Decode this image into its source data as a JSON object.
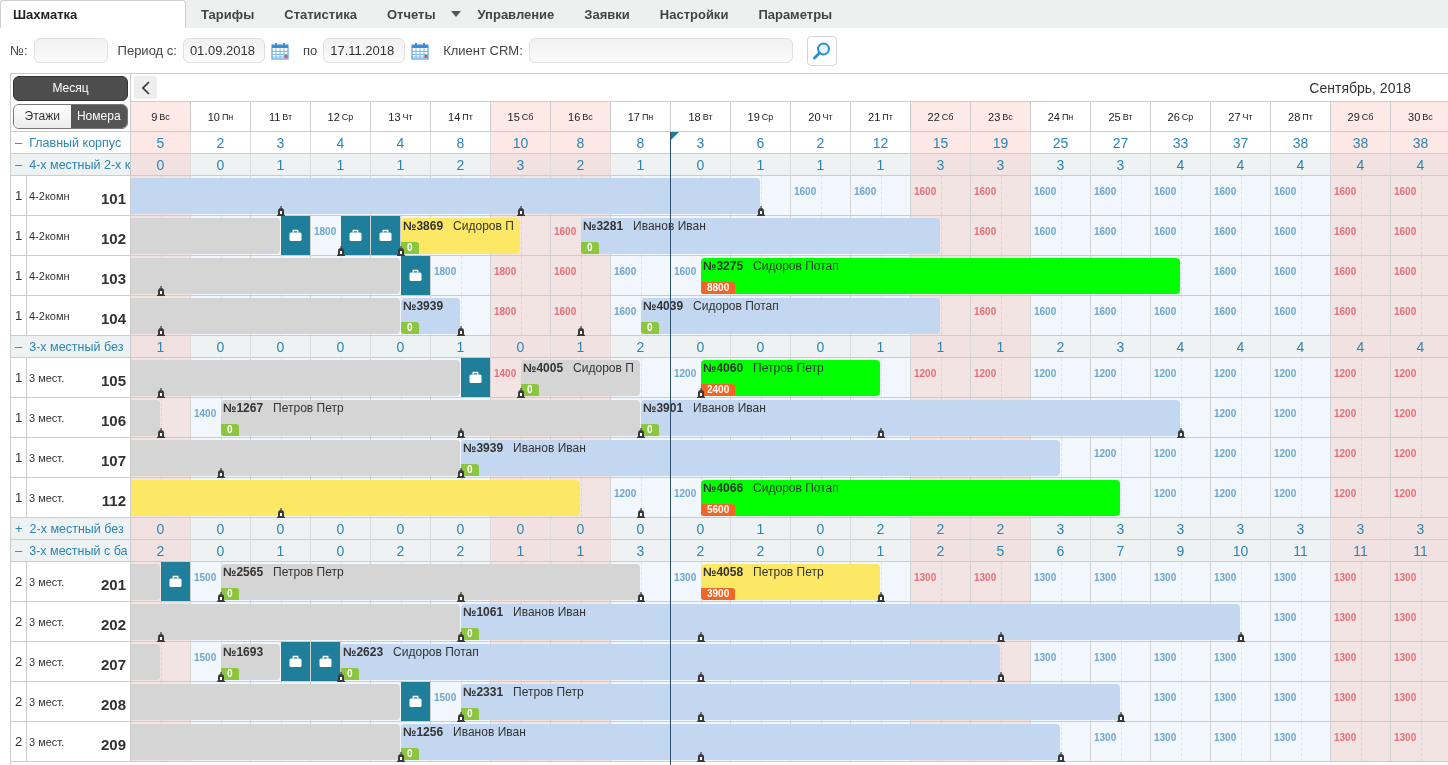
{
  "tabs": [
    {
      "label": "Шахматка",
      "selected": true,
      "dropdown": false
    },
    {
      "label": "Тарифы",
      "selected": false,
      "dropdown": false
    },
    {
      "label": "Статистика",
      "selected": false,
      "dropdown": false
    },
    {
      "label": "Отчеты",
      "selected": false,
      "dropdown": true
    },
    {
      "label": "Управление",
      "selected": false,
      "dropdown": false
    },
    {
      "label": "Заявки",
      "selected": false,
      "dropdown": false
    },
    {
      "label": "Настройки",
      "selected": false,
      "dropdown": false
    },
    {
      "label": "Параметры",
      "selected": false,
      "dropdown": false
    }
  ],
  "filters": [
    {
      "kind": "text",
      "label": "№:"
    },
    {
      "kind": "date",
      "label": "Период с:",
      "value": "01.09.2018"
    },
    {
      "kind": "date",
      "label": "по",
      "value": "17.11.2018"
    },
    {
      "kind": "wide",
      "label": "Клиент CRM:"
    }
  ],
  "view": {
    "month_button": "Месяц",
    "modes": [
      {
        "label": "Этажи",
        "selected": false
      },
      {
        "label": "Номера",
        "selected": true
      }
    ],
    "month_title": "Сентябрь, 2018"
  },
  "days": [
    {
      "day": "9",
      "weekday": "Вс",
      "weekend": true,
      "today": false
    },
    {
      "day": "10",
      "weekday": "Пн",
      "weekend": false,
      "today": false
    },
    {
      "day": "11",
      "weekday": "Вт",
      "weekend": false,
      "today": false
    },
    {
      "day": "12",
      "weekday": "Ср",
      "weekend": false,
      "today": false
    },
    {
      "day": "13",
      "weekday": "Чт",
      "weekend": false,
      "today": false
    },
    {
      "day": "14",
      "weekday": "Пт",
      "weekend": false,
      "today": false
    },
    {
      "day": "15",
      "weekday": "Сб",
      "weekend": true,
      "today": false
    },
    {
      "day": "16",
      "weekday": "Вс",
      "weekend": true,
      "today": false
    },
    {
      "day": "17",
      "weekday": "Пн",
      "weekend": false,
      "today": false
    },
    {
      "day": "18",
      "weekday": "Вт",
      "weekend": false,
      "today": true
    },
    {
      "day": "19",
      "weekday": "Ср",
      "weekend": false,
      "today": false
    },
    {
      "day": "20",
      "weekday": "Чт",
      "weekend": false,
      "today": false
    },
    {
      "day": "21",
      "weekday": "Пт",
      "weekend": false,
      "today": false
    },
    {
      "day": "22",
      "weekday": "Сб",
      "weekend": true,
      "today": false
    },
    {
      "day": "23",
      "weekday": "Вс",
      "weekend": true,
      "today": false
    },
    {
      "day": "24",
      "weekday": "Пн",
      "weekend": false,
      "today": false
    },
    {
      "day": "25",
      "weekday": "Вт",
      "weekend": false,
      "today": false
    },
    {
      "day": "26",
      "weekday": "Ср",
      "weekend": false,
      "today": false
    },
    {
      "day": "27",
      "weekday": "Чт",
      "weekend": false,
      "today": false
    },
    {
      "day": "28",
      "weekday": "Пт",
      "weekend": false,
      "today": false
    },
    {
      "day": "29",
      "weekday": "Сб",
      "weekend": true,
      "today": false
    },
    {
      "day": "30",
      "weekday": "Вс",
      "weekend": true,
      "today": false
    }
  ],
  "rows": [
    {
      "kind": "building",
      "toggle": "–",
      "name": "Главный корпус",
      "counts": [
        "5",
        "2",
        "3",
        "4",
        "4",
        "8",
        "10",
        "8",
        "8",
        "3",
        "6",
        "2",
        "12",
        "15",
        "19",
        "25",
        "27",
        "33",
        "37",
        "38",
        "38",
        "38"
      ]
    },
    {
      "kind": "category",
      "toggle": "–",
      "name": "4-х местный 2-х к",
      "counts": [
        "0",
        "0",
        "1",
        "1",
        "1",
        "2",
        "3",
        "2",
        "1",
        "0",
        "1",
        "1",
        "1",
        "3",
        "3",
        "3",
        "3",
        "4",
        "4",
        "4",
        "4",
        "4"
      ]
    },
    {
      "kind": "room",
      "floor": "1",
      "room_type": "4-2комн",
      "number": "101",
      "cells": [
        {
          "marker": false,
          "arrivals": [
            {
              "kind": "booking",
              "color": "#c4d7f0",
              "continued": true
            }
          ]
        },
        {
          "marker": false
        },
        {
          "marker": true
        },
        {
          "marker": false
        },
        {
          "marker": false
        },
        {
          "marker": false
        },
        {
          "marker": true
        },
        {
          "marker": false
        },
        {
          "marker": false
        },
        {
          "marker": false
        },
        {
          "marker": true,
          "departures": [
            {
              "midday": true
            }
          ]
        },
        {
          "marker": false,
          "price": "1600"
        },
        {
          "marker": false,
          "price": "1600"
        },
        {
          "marker": false,
          "price": "1600"
        },
        {
          "marker": false,
          "price": "1600"
        },
        {
          "marker": false,
          "price": "1600"
        },
        {
          "marker": false,
          "price": "1600"
        },
        {
          "marker": false,
          "price": "1600"
        },
        {
          "marker": false,
          "price": "1600"
        },
        {
          "marker": false,
          "price": "1600"
        },
        {
          "marker": false,
          "price": "1600"
        },
        {
          "marker": false,
          "price": "1600"
        }
      ]
    },
    {
      "kind": "room",
      "floor": "1",
      "room_type": "4-2комн",
      "number": "102",
      "cells": [
        {
          "marker": false,
          "arrivals": [
            {
              "kind": "booking",
              "color": "#d5d5d5",
              "continued": true
            }
          ]
        },
        {
          "marker": false
        },
        {
          "marker": false,
          "departures": [
            {
              "midday": true
            }
          ],
          "arrivals": [
            {
              "kind": "luggage",
              "color": "#1f7f9a",
              "continued": false,
              "midday": true
            }
          ]
        },
        {
          "marker": true,
          "price": "1800",
          "departures": [
            {
              "midday": false
            }
          ],
          "arrivals": [
            {
              "kind": "luggage",
              "color": "#1f7f9a",
              "continued": false,
              "midday": true
            }
          ]
        },
        {
          "marker": true,
          "departures": [
            {
              "midday": false
            },
            {
              "midday": true
            }
          ],
          "arrivals": [
            {
              "kind": "luggage",
              "color": "#1f7f9a",
              "continued": false,
              "midday": false
            },
            {
              "kind": "booking",
              "color": "#fde866",
              "continued": false,
              "midday": true,
              "label": "**№3869**   Сидоров П",
              "badge": {
                "text": "0",
                "color": "#8cc63f"
              }
            }
          ]
        },
        {
          "marker": false
        },
        {
          "marker": false,
          "departures": [
            {
              "midday": true
            }
          ]
        },
        {
          "marker": false,
          "price": "1600",
          "arrivals": [
            {
              "kind": "booking",
              "color": "#c4d7f0",
              "continued": false,
              "midday": true,
              "label": "**№3281**   Иванов Иван",
              "badge": {
                "text": "0",
                "color": "#8cc63f"
              }
            }
          ]
        },
        {
          "marker": false
        },
        {
          "marker": false
        },
        {
          "marker": false
        },
        {
          "marker": false
        },
        {
          "marker": false
        },
        {
          "marker": false,
          "departures": [
            {
              "midday": true
            }
          ]
        },
        {
          "marker": false,
          "price": "1600"
        },
        {
          "marker": false,
          "price": "1600"
        },
        {
          "marker": false,
          "price": "1600"
        },
        {
          "marker": false,
          "price": "1600"
        },
        {
          "marker": false,
          "price": "1600"
        },
        {
          "marker": false,
          "price": "1600"
        },
        {
          "marker": false,
          "price": "1600"
        },
        {
          "marker": false,
          "price": "1600"
        }
      ]
    },
    {
      "kind": "room",
      "floor": "1",
      "room_type": "4-2комн",
      "number": "103",
      "cells": [
        {
          "marker": true,
          "arrivals": [
            {
              "kind": "booking",
              "color": "#d5d5d5",
              "continued": true
            }
          ]
        },
        {
          "marker": false
        },
        {
          "marker": false
        },
        {
          "marker": false
        },
        {
          "marker": false,
          "departures": [
            {
              "midday": true
            }
          ],
          "arrivals": [
            {
              "kind": "luggage",
              "color": "#1f7f9a",
              "continued": false,
              "midday": true
            }
          ]
        },
        {
          "marker": false,
          "price": "1800",
          "departures": [
            {
              "midday": false
            }
          ]
        },
        {
          "marker": false,
          "price": "1800"
        },
        {
          "marker": false,
          "price": "1600"
        },
        {
          "marker": false,
          "price": "1600"
        },
        {
          "marker": false,
          "price": "1600",
          "arrivals": [
            {
              "kind": "booking",
              "color": "#00ff00",
              "continued": false,
              "midday": true,
              "label": "**№3275**   Сидоров Потап",
              "badge": {
                "text": "8800",
                "color": "#f26522"
              }
            }
          ]
        },
        {
          "marker": false
        },
        {
          "marker": false
        },
        {
          "marker": false
        },
        {
          "marker": false
        },
        {
          "marker": false
        },
        {
          "marker": false
        },
        {
          "marker": false
        },
        {
          "marker": false,
          "departures": [
            {
              "midday": true
            }
          ]
        },
        {
          "marker": false,
          "price": "1600"
        },
        {
          "marker": false,
          "price": "1600"
        },
        {
          "marker": false,
          "price": "1600"
        },
        {
          "marker": false,
          "price": "1600"
        }
      ]
    },
    {
      "kind": "room",
      "floor": "1",
      "room_type": "4-2комн",
      "number": "104",
      "cells": [
        {
          "marker": true,
          "arrivals": [
            {
              "kind": "booking",
              "color": "#d5d5d5",
              "continued": true
            }
          ]
        },
        {
          "marker": false
        },
        {
          "marker": false
        },
        {
          "marker": false
        },
        {
          "marker": false,
          "departures": [
            {
              "midday": true
            }
          ],
          "arrivals": [
            {
              "kind": "booking",
              "color": "#c4d7f0",
              "continued": false,
              "midday": true,
              "label": "**№3939**",
              "badge": {
                "text": "0",
                "color": "#8cc63f"
              }
            }
          ]
        },
        {
          "marker": true,
          "departures": [
            {
              "midday": true
            }
          ]
        },
        {
          "marker": false,
          "price": "1800"
        },
        {
          "marker": true,
          "price": "1600"
        },
        {
          "marker": false,
          "price": "1600",
          "arrivals": [
            {
              "kind": "booking",
              "color": "#c4d7f0",
              "continued": false,
              "midday": true,
              "label": "**№4039**   Сидоров Потап",
              "badge": {
                "text": "0",
                "color": "#8cc63f"
              }
            }
          ]
        },
        {
          "marker": false
        },
        {
          "marker": false
        },
        {
          "marker": false
        },
        {
          "marker": false
        },
        {
          "marker": false,
          "departures": [
            {
              "midday": true
            }
          ]
        },
        {
          "marker": false,
          "price": "1600"
        },
        {
          "marker": false,
          "price": "1600"
        },
        {
          "marker": false,
          "price": "1600"
        },
        {
          "marker": false,
          "price": "1600"
        },
        {
          "marker": false,
          "price": "1600"
        },
        {
          "marker": false,
          "price": "1600"
        },
        {
          "marker": false,
          "price": "1600"
        },
        {
          "marker": false,
          "price": "1600"
        }
      ]
    },
    {
      "kind": "category",
      "toggle": "–",
      "name": "3-х местный без",
      "counts": [
        "1",
        "0",
        "0",
        "0",
        "0",
        "1",
        "0",
        "1",
        "2",
        "0",
        "0",
        "0",
        "1",
        "1",
        "1",
        "2",
        "3",
        "4",
        "4",
        "4",
        "4",
        "4"
      ]
    },
    {
      "kind": "room",
      "floor": "1",
      "room_type": "3 мест.",
      "number": "105",
      "cells": [
        {
          "marker": true,
          "arrivals": [
            {
              "kind": "booking",
              "color": "#d5d5d5",
              "continued": true
            }
          ]
        },
        {
          "marker": false
        },
        {
          "marker": false
        },
        {
          "marker": false
        },
        {
          "marker": false
        },
        {
          "marker": false,
          "departures": [
            {
              "midday": true
            }
          ],
          "arrivals": [
            {
              "kind": "luggage",
              "color": "#1f7f9a",
              "continued": false,
              "midday": true
            }
          ]
        },
        {
          "marker": true,
          "price": "1400",
          "departures": [
            {
              "midday": false
            }
          ],
          "arrivals": [
            {
              "kind": "booking",
              "color": "#d5d5d5",
              "continued": false,
              "midday": true,
              "label": "**№4005**   Сидоров П",
              "badge": {
                "text": "0",
                "color": "#8cc63f"
              }
            }
          ]
        },
        {
          "marker": false
        },
        {
          "marker": false,
          "departures": [
            {
              "midday": true
            }
          ]
        },
        {
          "marker": true,
          "price": "1200",
          "arrivals": [
            {
              "kind": "booking",
              "color": "#00ff00",
              "continued": false,
              "midday": true,
              "label": "**№4060**   Петров Петр",
              "badge": {
                "text": "2400",
                "color": "#f26522"
              }
            }
          ]
        },
        {
          "marker": false
        },
        {
          "marker": false
        },
        {
          "marker": false,
          "departures": [
            {
              "midday": true
            }
          ]
        },
        {
          "marker": false,
          "price": "1200"
        },
        {
          "marker": false,
          "price": "1200"
        },
        {
          "marker": false,
          "price": "1200"
        },
        {
          "marker": false,
          "price": "1200"
        },
        {
          "marker": false,
          "price": "1200"
        },
        {
          "marker": false,
          "price": "1200"
        },
        {
          "marker": false,
          "price": "1200"
        },
        {
          "marker": false,
          "price": "1200"
        },
        {
          "marker": false,
          "price": "1200"
        }
      ]
    },
    {
      "kind": "room",
      "floor": "1",
      "room_type": "3 мест.",
      "number": "106",
      "cells": [
        {
          "marker": true,
          "arrivals": [
            {
              "kind": "booking",
              "color": "#d5d5d5",
              "continued": true
            }
          ],
          "departures": [
            {
              "midday": true
            }
          ]
        },
        {
          "marker": false,
          "price": "1400",
          "arrivals": [
            {
              "kind": "booking",
              "color": "#d5d5d5",
              "continued": false,
              "midday": true,
              "label": "**№1267**   Петров Петр",
              "badge": {
                "text": "0",
                "color": "#8cc63f"
              }
            }
          ]
        },
        {
          "marker": false
        },
        {
          "marker": false
        },
        {
          "marker": false
        },
        {
          "marker": true
        },
        {
          "marker": false
        },
        {
          "marker": false
        },
        {
          "marker": true,
          "departures": [
            {
              "midday": true
            }
          ],
          "arrivals": [
            {
              "kind": "booking",
              "color": "#c4d7f0",
              "continued": false,
              "midday": true,
              "label": "**№3901**   Иванов Иван",
              "badge": {
                "text": "0",
                "color": "#8cc63f"
              }
            }
          ]
        },
        {
          "marker": false
        },
        {
          "marker": false
        },
        {
          "marker": false
        },
        {
          "marker": true
        },
        {
          "marker": false
        },
        {
          "marker": false
        },
        {
          "marker": false
        },
        {
          "marker": false
        },
        {
          "marker": true,
          "departures": [
            {
              "midday": true
            }
          ]
        },
        {
          "marker": false,
          "price": "1200"
        },
        {
          "marker": false,
          "price": "1200"
        },
        {
          "marker": false,
          "price": "1200"
        },
        {
          "marker": false,
          "price": "1200"
        }
      ]
    },
    {
      "kind": "room",
      "floor": "1",
      "room_type": "3 мест.",
      "number": "107",
      "cells": [
        {
          "marker": false,
          "arrivals": [
            {
              "kind": "booking",
              "color": "#d5d5d5",
              "continued": true
            }
          ]
        },
        {
          "marker": true
        },
        {
          "marker": false
        },
        {
          "marker": false
        },
        {
          "marker": false
        },
        {
          "marker": true,
          "departures": [
            {
              "midday": true
            }
          ],
          "arrivals": [
            {
              "kind": "booking",
              "color": "#c4d7f0",
              "continued": false,
              "midday": true,
              "label": "**№3939**   Иванов Иван",
              "badge": {
                "text": "0",
                "color": "#8cc63f"
              }
            }
          ]
        },
        {
          "marker": false
        },
        {
          "marker": false
        },
        {
          "marker": false
        },
        {
          "marker": false
        },
        {
          "marker": false
        },
        {
          "marker": false
        },
        {
          "marker": false
        },
        {
          "marker": false
        },
        {
          "marker": false
        },
        {
          "marker": false,
          "departures": [
            {
              "midday": true
            }
          ]
        },
        {
          "marker": false,
          "price": "1200"
        },
        {
          "marker": false,
          "price": "1200"
        },
        {
          "marker": false,
          "price": "1200"
        },
        {
          "marker": false,
          "price": "1200"
        },
        {
          "marker": false,
          "price": "1200"
        },
        {
          "marker": false,
          "price": "1200"
        }
      ]
    },
    {
      "kind": "room",
      "floor": "1",
      "room_type": "3 мест.",
      "number": "112",
      "cells": [
        {
          "marker": false,
          "arrivals": [
            {
              "kind": "booking",
              "color": "#fde866",
              "continued": true
            }
          ]
        },
        {
          "marker": false
        },
        {
          "marker": true
        },
        {
          "marker": false
        },
        {
          "marker": false
        },
        {
          "marker": false
        },
        {
          "marker": false
        },
        {
          "marker": false,
          "departures": [
            {
              "midday": true
            }
          ]
        },
        {
          "marker": true,
          "price": "1200"
        },
        {
          "marker": false,
          "price": "1200",
          "arrivals": [
            {
              "kind": "booking",
              "color": "#00ff00",
              "continued": false,
              "midday": true,
              "label": "**№4066**   Сидоров Потап",
              "badge": {
                "text": "5600",
                "color": "#f26522"
              }
            }
          ]
        },
        {
          "marker": false
        },
        {
          "marker": false
        },
        {
          "marker": false
        },
        {
          "marker": false
        },
        {
          "marker": false
        },
        {
          "marker": false
        },
        {
          "marker": false,
          "departures": [
            {
              "midday": true
            }
          ]
        },
        {
          "marker": false,
          "price": "1200"
        },
        {
          "marker": false,
          "price": "1200"
        },
        {
          "marker": false,
          "price": "1200"
        },
        {
          "marker": false,
          "price": "1200"
        },
        {
          "marker": false,
          "price": "1200"
        }
      ]
    },
    {
      "kind": "category",
      "toggle": "+",
      "name": "2-х местный без",
      "counts": [
        "0",
        "0",
        "0",
        "0",
        "0",
        "0",
        "0",
        "0",
        "0",
        "0",
        "1",
        "0",
        "2",
        "2",
        "2",
        "3",
        "3",
        "3",
        "3",
        "3",
        "3",
        "3"
      ]
    },
    {
      "kind": "category",
      "toggle": "–",
      "name": "3-х местный с ба",
      "counts": [
        "2",
        "0",
        "1",
        "0",
        "2",
        "2",
        "1",
        "1",
        "3",
        "2",
        "2",
        "0",
        "1",
        "2",
        "5",
        "6",
        "7",
        "9",
        "10",
        "11",
        "11",
        "11"
      ]
    },
    {
      "kind": "room",
      "floor": "2",
      "room_type": "3 мест.",
      "number": "201",
      "cells": [
        {
          "marker": false,
          "arrivals": [
            {
              "kind": "booking",
              "color": "#d5d5d5",
              "continued": true
            },
            {
              "kind": "luggage",
              "color": "#1f7f9a",
              "continued": false,
              "midday": true
            }
          ],
          "departures": [
            {
              "midday": true
            }
          ]
        },
        {
          "marker": true,
          "price": "1500",
          "departures": [
            {
              "midday": false
            }
          ],
          "arrivals": [
            {
              "kind": "booking",
              "color": "#d5d5d5",
              "continued": false,
              "midday": true,
              "label": "**№2565**   Петров Петр",
              "badge": {
                "text": "0",
                "color": "#8cc63f"
              }
            }
          ]
        },
        {
          "marker": false
        },
        {
          "marker": false
        },
        {
          "marker": false
        },
        {
          "marker": true
        },
        {
          "marker": false
        },
        {
          "marker": false
        },
        {
          "marker": true,
          "departures": [
            {
              "midday": true
            }
          ]
        },
        {
          "marker": false,
          "price": "1300",
          "arrivals": [
            {
              "kind": "booking",
              "color": "#fde866",
              "continued": false,
              "midday": true,
              "label": "**№4058**   Петров Петр",
              "badge": {
                "text": "3900",
                "color": "#f26522"
              }
            }
          ]
        },
        {
          "marker": false
        },
        {
          "marker": false
        },
        {
          "marker": true,
          "departures": [
            {
              "midday": true
            }
          ]
        },
        {
          "marker": false,
          "price": "1300"
        },
        {
          "marker": false,
          "price": "1300"
        },
        {
          "marker": false,
          "price": "1300"
        },
        {
          "marker": false,
          "price": "1300"
        },
        {
          "marker": false,
          "price": "1300"
        },
        {
          "marker": false,
          "price": "1300"
        },
        {
          "marker": false,
          "price": "1300"
        },
        {
          "marker": false,
          "price": "1300"
        },
        {
          "marker": false,
          "price": "1300"
        }
      ]
    },
    {
      "kind": "room",
      "floor": "2",
      "room_type": "3 мест.",
      "number": "202",
      "cells": [
        {
          "marker": true,
          "arrivals": [
            {
              "kind": "booking",
              "color": "#d5d5d5",
              "continued": true
            }
          ]
        },
        {
          "marker": false
        },
        {
          "marker": false
        },
        {
          "marker": false
        },
        {
          "marker": false
        },
        {
          "marker": true,
          "departures": [
            {
              "midday": true
            }
          ],
          "arrivals": [
            {
              "kind": "booking",
              "color": "#c4d7f0",
              "continued": false,
              "midday": true,
              "label": "**№1061**   Иванов Иван",
              "badge": {
                "text": "0",
                "color": "#8cc63f"
              }
            }
          ]
        },
        {
          "marker": false
        },
        {
          "marker": false
        },
        {
          "marker": false
        },
        {
          "marker": true
        },
        {
          "marker": false
        },
        {
          "marker": false
        },
        {
          "marker": false
        },
        {
          "marker": false
        },
        {
          "marker": true
        },
        {
          "marker": false
        },
        {
          "marker": false
        },
        {
          "marker": false
        },
        {
          "marker": true,
          "departures": [
            {
              "midday": true
            }
          ]
        },
        {
          "marker": false,
          "price": "1300"
        },
        {
          "marker": false,
          "price": "1300"
        },
        {
          "marker": false,
          "price": "1300"
        }
      ]
    },
    {
      "kind": "room",
      "floor": "2",
      "room_type": "3 мест.",
      "number": "207",
      "cells": [
        {
          "marker": false,
          "arrivals": [
            {
              "kind": "booking",
              "color": "#d5d5d5",
              "continued": true
            }
          ],
          "departures": [
            {
              "midday": true
            }
          ]
        },
        {
          "marker": true,
          "price": "1500",
          "arrivals": [
            {
              "kind": "booking",
              "color": "#d5d5d5",
              "continued": false,
              "midday": true,
              "label": "**№1693**",
              "badge": {
                "text": "0",
                "color": "#8cc63f"
              }
            }
          ]
        },
        {
          "marker": false,
          "departures": [
            {
              "midday": true
            }
          ],
          "arrivals": [
            {
              "kind": "luggage",
              "color": "#1f7f9a",
              "continued": false,
              "midday": true
            }
          ]
        },
        {
          "marker": true,
          "departures": [
            {
              "midday": false
            },
            {
              "midday": true
            }
          ],
          "arrivals": [
            {
              "kind": "luggage",
              "color": "#1f7f9a",
              "continued": false,
              "midday": false
            },
            {
              "kind": "booking",
              "color": "#c4d7f0",
              "continued": false,
              "midday": true,
              "label": "**№2623**   Сидоров Потап",
              "badge": {
                "text": "0",
                "color": "#8cc63f"
              }
            }
          ]
        },
        {
          "marker": false
        },
        {
          "marker": false
        },
        {
          "marker": false
        },
        {
          "marker": false
        },
        {
          "marker": false
        },
        {
          "marker": true
        },
        {
          "marker": false
        },
        {
          "marker": false
        },
        {
          "marker": false
        },
        {
          "marker": false
        },
        {
          "marker": true,
          "departures": [
            {
              "midday": true
            }
          ]
        },
        {
          "marker": false,
          "price": "1300"
        },
        {
          "marker": false,
          "price": "1300"
        },
        {
          "marker": false,
          "price": "1300"
        },
        {
          "marker": false,
          "price": "1300"
        },
        {
          "marker": false,
          "price": "1300"
        },
        {
          "marker": false,
          "price": "1300"
        },
        {
          "marker": false,
          "price": "1300"
        }
      ]
    },
    {
      "kind": "room",
      "floor": "2",
      "room_type": "3 мест.",
      "number": "208",
      "cells": [
        {
          "marker": false,
          "arrivals": [
            {
              "kind": "booking",
              "color": "#d5d5d5",
              "continued": true
            }
          ]
        },
        {
          "marker": false
        },
        {
          "marker": false
        },
        {
          "marker": false
        },
        {
          "marker": false,
          "departures": [
            {
              "midday": true
            }
          ],
          "arrivals": [
            {
              "kind": "luggage",
              "color": "#1f7f9a",
              "continued": false,
              "midday": true
            }
          ]
        },
        {
          "marker": true,
          "price": "1500",
          "departures": [
            {
              "midday": false
            }
          ],
          "arrivals": [
            {
              "kind": "booking",
              "color": "#c4d7f0",
              "continued": false,
              "midday": true,
              "label": "**№2331**   Петров Петр",
              "badge": {
                "text": "0",
                "color": "#8cc63f"
              }
            }
          ]
        },
        {
          "marker": false
        },
        {
          "marker": false
        },
        {
          "marker": false
        },
        {
          "marker": true
        },
        {
          "marker": false
        },
        {
          "marker": false
        },
        {
          "marker": false
        },
        {
          "marker": false
        },
        {
          "marker": false
        },
        {
          "marker": false
        },
        {
          "marker": true,
          "departures": [
            {
              "midday": true
            }
          ]
        },
        {
          "marker": false,
          "price": "1300"
        },
        {
          "marker": false,
          "price": "1300"
        },
        {
          "marker": false,
          "price": "1300"
        },
        {
          "marker": false,
          "price": "1300"
        },
        {
          "marker": false,
          "price": "1300"
        }
      ]
    },
    {
      "kind": "room",
      "floor": "2",
      "room_type": "3 мест.",
      "number": "209",
      "cells": [
        {
          "marker": false,
          "arrivals": [
            {
              "kind": "booking",
              "color": "#d5d5d5",
              "continued": true
            }
          ]
        },
        {
          "marker": false
        },
        {
          "marker": false
        },
        {
          "marker": false
        },
        {
          "marker": true,
          "departures": [
            {
              "midday": true
            }
          ],
          "arrivals": [
            {
              "kind": "booking",
              "color": "#c4d7f0",
              "continued": false,
              "midday": true,
              "label": "**№1256**   Иванов Иван",
              "badge": {
                "text": "0",
                "color": "#8cc63f"
              }
            }
          ]
        },
        {
          "marker": false
        },
        {
          "marker": false
        },
        {
          "marker": false
        },
        {
          "marker": false
        },
        {
          "marker": true
        },
        {
          "marker": false
        },
        {
          "marker": false
        },
        {
          "marker": false
        },
        {
          "marker": false
        },
        {
          "marker": false
        },
        {
          "marker": true,
          "departures": [
            {
              "midday": true
            }
          ]
        },
        {
          "marker": false,
          "price": "1300"
        },
        {
          "marker": false,
          "price": "1300"
        },
        {
          "marker": false,
          "price": "1300"
        },
        {
          "marker": false,
          "price": "1300"
        },
        {
          "marker": false,
          "price": "1300"
        },
        {
          "marker": false,
          "price": "1300"
        }
      ]
    }
  ]
}
